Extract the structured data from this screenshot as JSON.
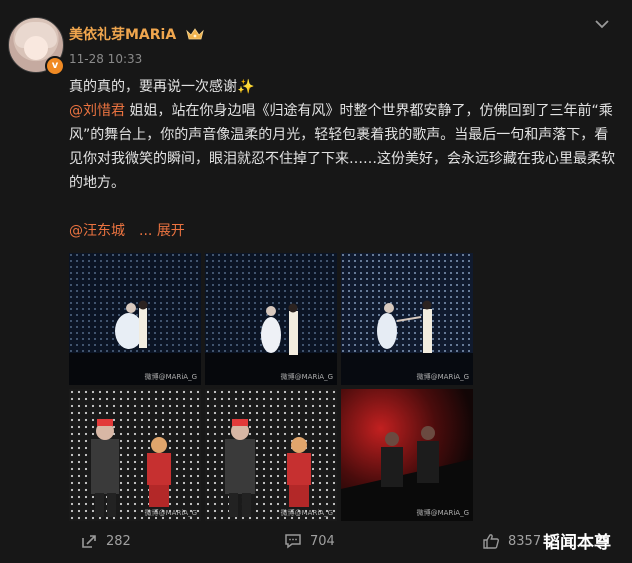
{
  "post": {
    "username": "美依礼芽MARiA",
    "timestamp": "11-28 10:33",
    "line1_text": "真的真的，要再说一次感谢",
    "line1_emoji": "✨",
    "mention_1": "@刘惜君",
    "body_text": " 姐姐，站在你身边唱《归途有风》时整个世界都安静了，仿佛回到了三年前“乘风”的舞台上，你的声音像温柔的月光，轻轻包裹着我的歌声。当最后一句和声落下，看见你对我微笑的瞬间，眼泪就忍不住掉了下来……这份美好，会永远珍藏在我心里最柔软的地方。",
    "mention_2": "@汪东城",
    "ellipsis": "...",
    "expand_label": "展开",
    "photo_watermark": "微博@MARiA_G"
  },
  "actions": {
    "repost_count": "282",
    "comment_count": "704",
    "like_count": "8357"
  },
  "overlay_watermark": "韬闻本尊",
  "colors": {
    "username": "#f0a64e",
    "mention": "#eb7340",
    "background": "#171717"
  }
}
